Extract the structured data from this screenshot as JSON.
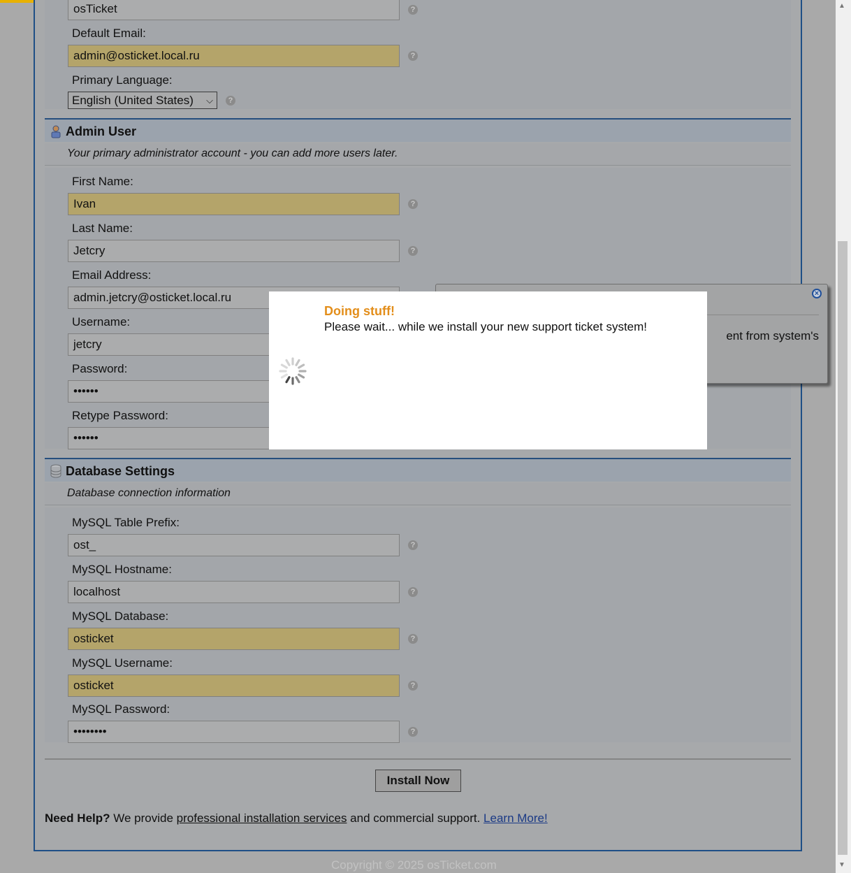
{
  "top_form": {
    "helpdesk_name_value": "osTicket",
    "default_email_label": "Default Email:",
    "default_email_value": "admin@osticket.local.ru",
    "primary_language_label": "Primary Language:",
    "primary_language_value": "English (United States)"
  },
  "admin_section": {
    "title": "Admin User",
    "subtitle": "Your primary administrator account - you can add more users later.",
    "first_name_label": "First Name:",
    "first_name_value": "Ivan",
    "last_name_label": "Last Name:",
    "last_name_value": "Jetcry",
    "email_label": "Email Address:",
    "email_value": "admin.jetcry@osticket.local.ru",
    "username_label": "Username:",
    "username_value": "jetcry",
    "password_label": "Password:",
    "password_value": "••••••",
    "retype_label": "Retype Password:",
    "retype_value": "••••••"
  },
  "db_section": {
    "title": "Database Settings",
    "subtitle": "Database connection information",
    "prefix_label": "MySQL Table Prefix:",
    "prefix_value": "ost_",
    "host_label": "MySQL Hostname:",
    "host_value": "localhost",
    "database_label": "MySQL Database:",
    "database_value": "osticket",
    "db_user_label": "MySQL Username:",
    "db_user_value": "osticket",
    "db_pass_label": "MySQL Password:",
    "db_pass_value": "••••••••"
  },
  "actions": {
    "install_label": "Install Now"
  },
  "help": {
    "lead": "Need Help?",
    "text1": " We provide ",
    "services_link": "professional installation services",
    "text2": " and commercial support. ",
    "learn_more": "Learn More!"
  },
  "footer": {
    "copyright": "Copyright © 2025 osTicket.com"
  },
  "tooltip": {
    "partial_text": "ent from system's"
  },
  "modal": {
    "title": "Doing stuff!",
    "message": "Please wait... while we install your new support ticket system!"
  },
  "icons": {
    "help": "help-icon",
    "admin": "user-icon",
    "database": "database-icon",
    "spinner": "spinner-icon",
    "close": "close-icon"
  },
  "colors": {
    "highlight_field": "#b4a46a",
    "modal_title": "#e38e1b",
    "section_border": "#264f7d",
    "link": "#1b3a86"
  }
}
